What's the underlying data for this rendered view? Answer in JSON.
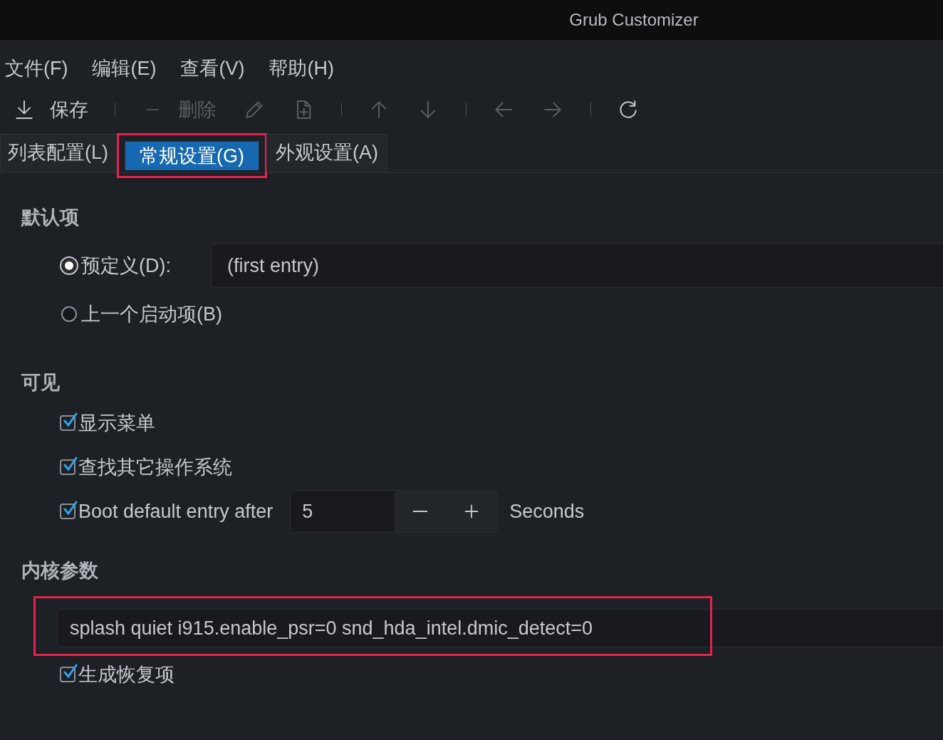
{
  "window": {
    "title": "Grub Customizer"
  },
  "menu": [
    "文件(F)",
    "编辑(E)",
    "查看(V)",
    "帮助(H)"
  ],
  "toolbar": [
    {
      "kind": "button",
      "label": "保存",
      "disabled": false
    },
    {
      "kind": "separator"
    },
    {
      "kind": "button",
      "label": "删除",
      "disabled": true
    },
    {
      "kind": "button",
      "disabled": true
    },
    {
      "kind": "button",
      "disabled": true
    },
    {
      "kind": "separator"
    },
    {
      "kind": "button",
      "disabled": true
    },
    {
      "kind": "button",
      "disabled": true
    },
    {
      "kind": "separator"
    },
    {
      "kind": "button",
      "disabled": true
    },
    {
      "kind": "button",
      "disabled": true
    },
    {
      "kind": "separator"
    },
    {
      "kind": "button",
      "disabled": false
    }
  ],
  "tabs": [
    {
      "label": "列表配置(L)",
      "selected": false,
      "highlighted": false
    },
    {
      "label": "常规设置(G)",
      "selected": true,
      "highlighted": true
    },
    {
      "label": "外观设置(A)",
      "selected": false,
      "highlighted": false
    }
  ],
  "default_entry": {
    "heading": "默认项",
    "options": [
      {
        "label": "预定义(D):",
        "selected": true,
        "value": "(first entry)"
      },
      {
        "label": "上一个启动项(B)",
        "selected": false
      }
    ]
  },
  "visibility": {
    "heading": "可见",
    "show_menu": {
      "label": "显示菜单",
      "checked": true
    },
    "look_for_other_os": {
      "label": "查找其它操作系统",
      "checked": true
    },
    "timeout": {
      "label": "Boot default entry after",
      "checked": true,
      "value": "5",
      "unit": "Seconds"
    }
  },
  "kernel_parameters": {
    "heading": "内核参数",
    "value": "splash quiet i915.enable_psr=0 snd_hda_intel.dmic_detect=0",
    "highlighted": true
  },
  "recovery": {
    "label": "生成恢复项",
    "checked": true
  }
}
